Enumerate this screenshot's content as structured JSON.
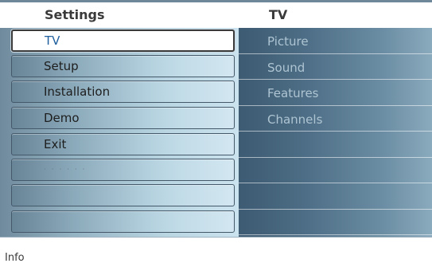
{
  "header": {
    "left_title": "Settings",
    "right_title": "TV"
  },
  "menu": {
    "items": [
      {
        "label": "TV",
        "selected": true
      },
      {
        "label": "Setup"
      },
      {
        "label": "Installation"
      },
      {
        "label": "Demo"
      },
      {
        "label": "Exit"
      },
      {
        "label": "· · · · · ·"
      },
      {
        "label": ""
      },
      {
        "label": ""
      }
    ]
  },
  "submenu": {
    "items": [
      {
        "label": "Picture"
      },
      {
        "label": "Sound"
      },
      {
        "label": "Features"
      },
      {
        "label": "Channels"
      },
      {
        "label": ""
      },
      {
        "label": ""
      },
      {
        "label": ""
      },
      {
        "label": ""
      }
    ]
  },
  "info": {
    "label": "Info"
  }
}
